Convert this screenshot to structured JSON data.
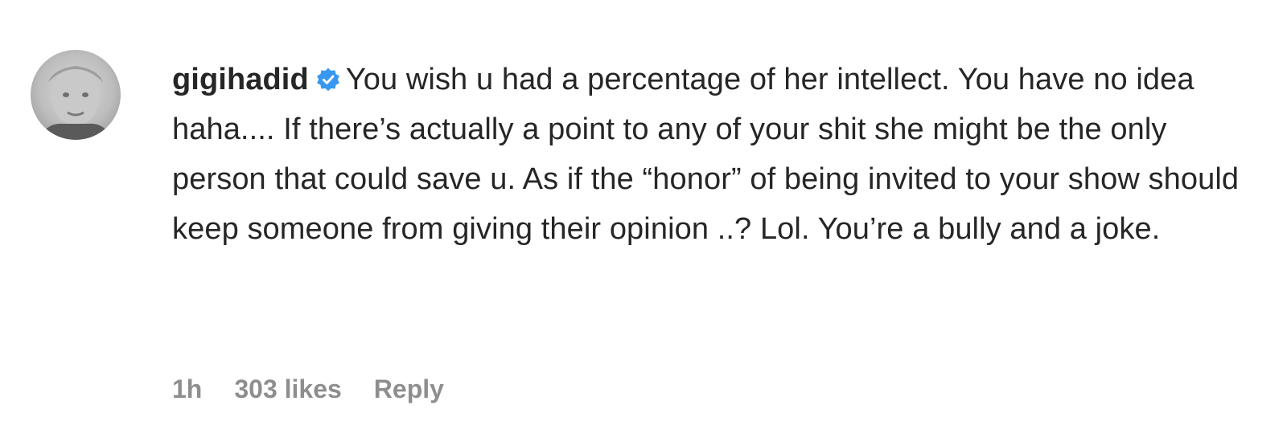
{
  "comment": {
    "avatar_icon": "profile-photo",
    "username": "gigihadid",
    "verified_icon": "verified-badge-icon",
    "verified_color": "#3897f0",
    "text": "You wish u had a percentage of her intellect. You have no idea haha.... If there’s actually a point to any of your shit she might be the only person that could save u. As if the “honor” of being invited to your show should keep someone from giving their opinion ..? Lol. You’re a bully and a joke.",
    "time": "1h",
    "likes": "303 likes",
    "reply_label": "Reply"
  }
}
